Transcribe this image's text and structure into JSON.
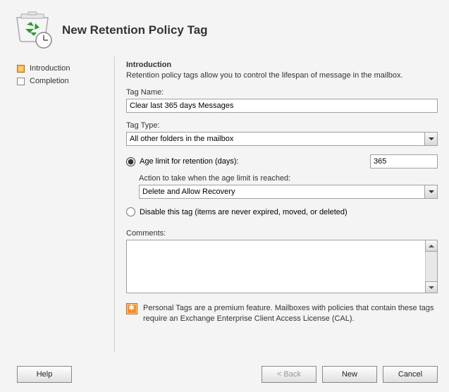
{
  "header": {
    "title": "New Retention Policy Tag"
  },
  "sidebar": {
    "steps": [
      {
        "label": "Introduction",
        "active": true
      },
      {
        "label": "Completion",
        "active": false
      }
    ]
  },
  "main": {
    "section_title": "Introduction",
    "section_desc": "Retention policy tags allow you to control the lifespan of message in the mailbox.",
    "tag_name_label": "Tag Name:",
    "tag_name_value": "Clear last 365 days Messages",
    "tag_type_label": "Tag Type:",
    "tag_type_value": "All other folders in the mailbox",
    "age_limit_label": "Age limit for retention (days):",
    "age_limit_value": "365",
    "action_label": "Action to take when the age limit is reached:",
    "action_value": "Delete and Allow Recovery",
    "disable_label": "Disable this tag (items are never expired, moved, or deleted)",
    "comments_label": "Comments:",
    "comments_value": "",
    "info_text": "Personal Tags are a premium feature. Mailboxes with policies that contain these tags require an Exchange Enterprise Client Access License (CAL)."
  },
  "footer": {
    "help_label": "Help",
    "back_label": "< Back",
    "next_label": "New",
    "cancel_label": "Cancel"
  },
  "radio": {
    "selected": "age_limit"
  }
}
